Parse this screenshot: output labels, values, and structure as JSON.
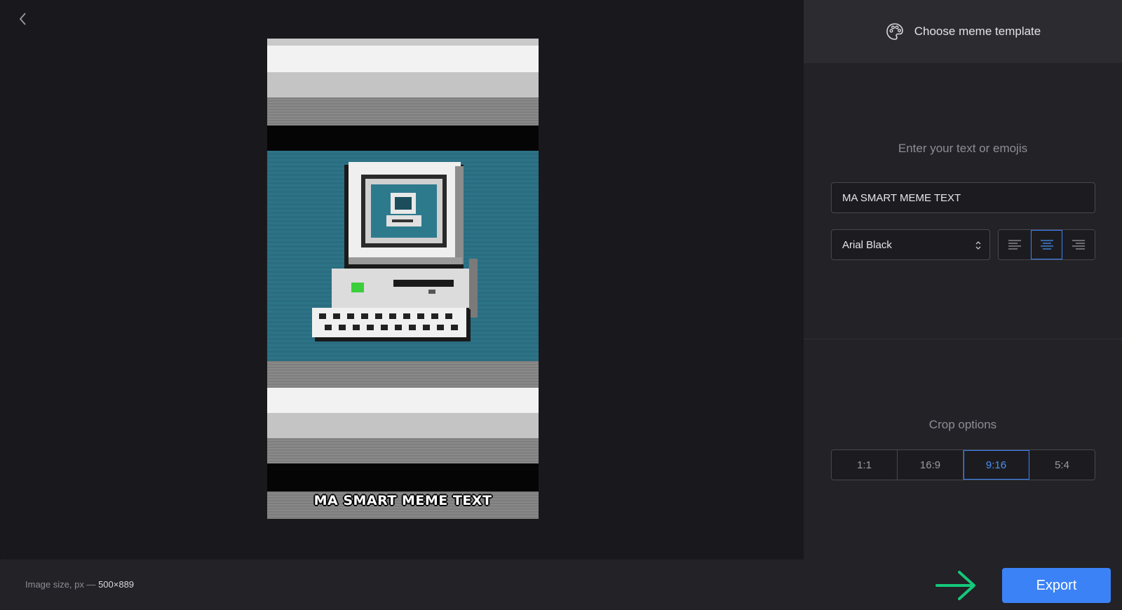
{
  "header": {
    "template_label": "Choose meme template"
  },
  "editor": {
    "text_section_label": "Enter your text or emojis",
    "text_value": "MA SMART MEME TEXT",
    "font": "Arial Black",
    "alignments": [
      "left",
      "center",
      "right"
    ],
    "active_alignment": "center"
  },
  "preview": {
    "meme_text": "MA SMART MEME TEXT"
  },
  "crop": {
    "label": "Crop options",
    "options": [
      "1:1",
      "16:9",
      "9:16",
      "5:4"
    ],
    "active": "9:16"
  },
  "footer": {
    "size_label": "Image size, px —",
    "size_value": "500×889",
    "export_label": "Export"
  },
  "colors": {
    "accent": "#3b82f6",
    "arrow": "#14c97a",
    "teal": "#2d7387"
  },
  "icons": [
    "back-chevron-icon",
    "palette-icon",
    "select-arrows-icon",
    "align-left-icon",
    "align-center-icon",
    "align-right-icon",
    "arrow-right-icon"
  ]
}
